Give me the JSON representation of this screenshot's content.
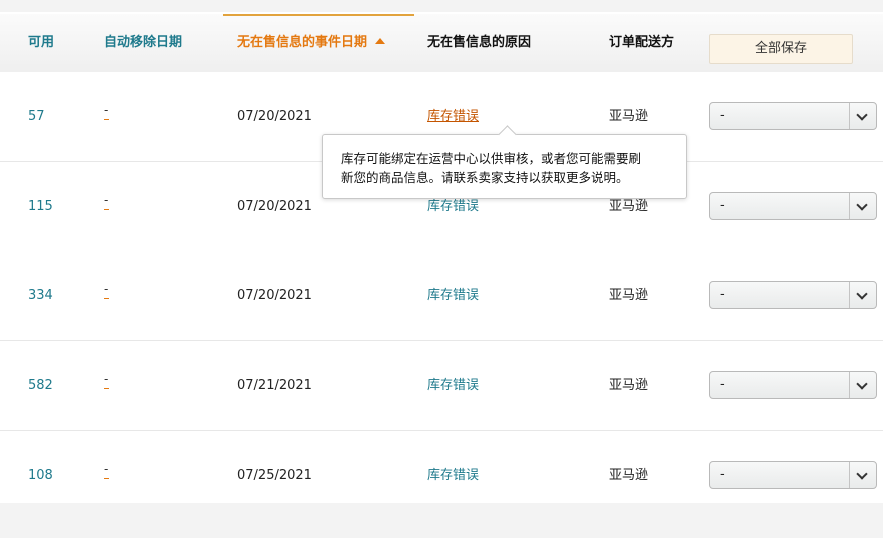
{
  "header": {
    "col_available": "可用",
    "col_removal_date": "自动移除日期",
    "col_event_date": "无在售信息的事件日期",
    "col_reason": "无在售信息的原因",
    "col_shipper": "订单配送方",
    "save_all": "全部保存"
  },
  "rows": [
    {
      "qty": "57",
      "removal_top": "-",
      "date": "07/20/2021",
      "reason": "库存错误",
      "shipper": "亚马逊",
      "select_value": "-"
    },
    {
      "qty": "115",
      "removal_top": "-",
      "date": "07/20/2021",
      "reason": "库存错误",
      "shipper": "亚马逊",
      "select_value": "-"
    },
    {
      "qty": "334",
      "removal_top": "-",
      "date": "07/20/2021",
      "reason": "库存错误",
      "shipper": "亚马逊",
      "select_value": "-"
    },
    {
      "qty": "582",
      "removal_top": "-",
      "date": "07/21/2021",
      "reason": "库存错误",
      "shipper": "亚马逊",
      "select_value": "-"
    },
    {
      "qty": "108",
      "removal_top": "-",
      "date": "07/25/2021",
      "reason": "库存错误",
      "shipper": "亚马逊",
      "select_value": "-"
    }
  ],
  "tooltip": {
    "line1": "库存可能绑定在运营中心以供审核，或者您可能需要刷",
    "line2": "新您的商品信息。请联系卖家支持以获取更多说明。"
  },
  "colors": {
    "link": "#1f7a8c",
    "accent_orange": "#e47911",
    "hover_link": "#c45500"
  }
}
